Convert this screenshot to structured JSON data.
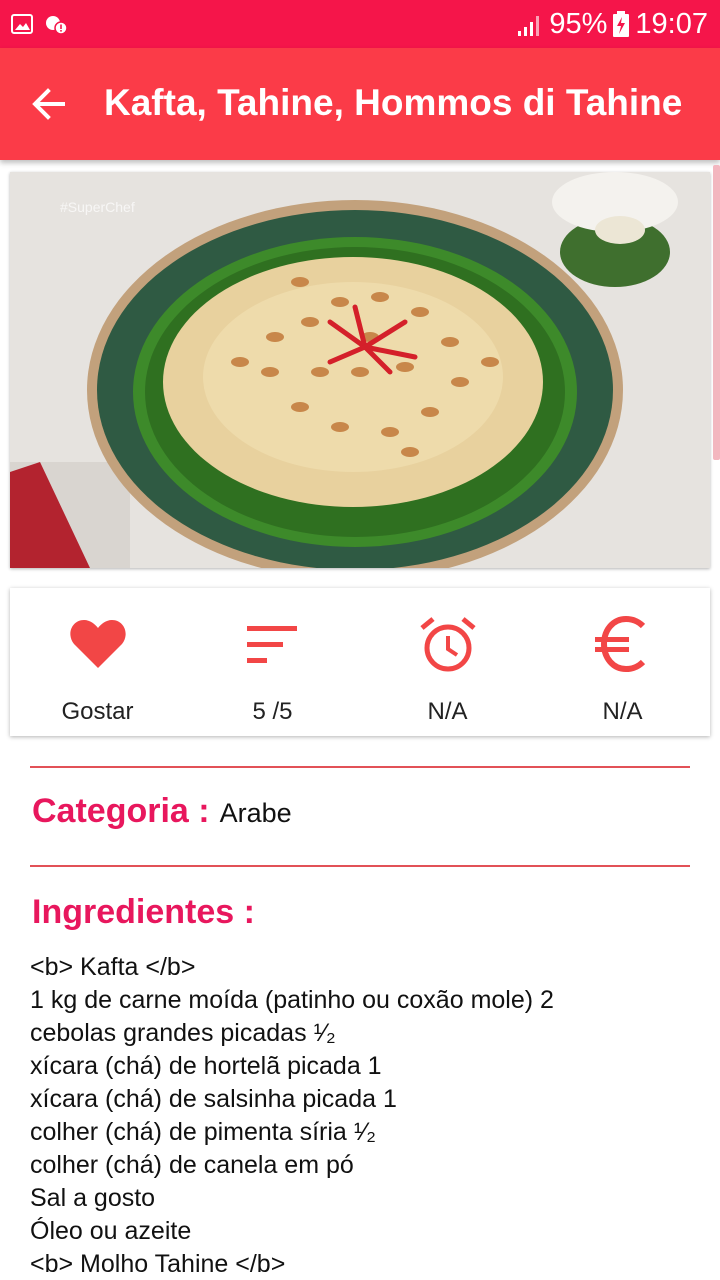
{
  "status_bar": {
    "battery": "95%",
    "time": "19:07",
    "icons": [
      "gallery-icon",
      "alert-icon",
      "signal-icon",
      "battery-charging-icon"
    ]
  },
  "app_bar": {
    "title": "Kafta, Tahine, Hommos di Tahine"
  },
  "image": {
    "watermark": "#SuperChef"
  },
  "stats": [
    {
      "icon": "heart-icon",
      "label": "Gostar"
    },
    {
      "icon": "sort-icon",
      "label": "5 /5"
    },
    {
      "icon": "alarm-icon",
      "label": "N/A"
    },
    {
      "icon": "euro-icon",
      "label": "N/A"
    }
  ],
  "category": {
    "label": "Categoria :",
    "value": "Arabe"
  },
  "ingredients": {
    "label": "Ingredientes :",
    "lines": [
      "<b> Kafta </b>",
      "1 kg de carne moída (patinho ou coxão mole) 2",
      "cebolas grandes picadas ¹⁄₂",
      "xícara (chá) de hortelã picada 1",
      "xícara (chá) de salsinha picada 1",
      "colher (chá) de pimenta síria ¹⁄₂",
      "colher (chá) de canela em pó",
      "Sal a gosto",
      "Óleo ou azeite",
      "<b> Molho Tahine </b>"
    ]
  },
  "colors": {
    "status_bar": "#f5154a",
    "app_bar": "#fb3b48",
    "accent": "#e8175d",
    "icon_red": "#f24646",
    "divider": "#e25157"
  }
}
